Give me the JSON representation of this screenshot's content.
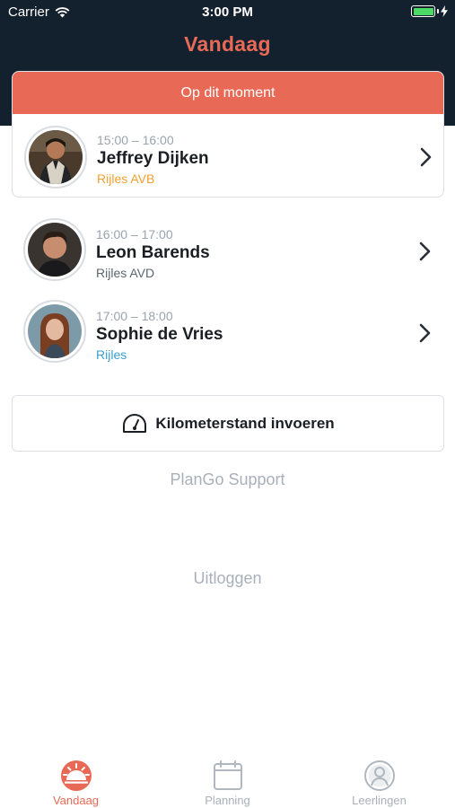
{
  "colors": {
    "header_bg": "#13202d",
    "accent": "#e86a56",
    "orange": "#f0a030",
    "teal_blue": "#3aa0d0",
    "muted": "#a9b0b9",
    "battery": "#4cd964"
  },
  "status_bar": {
    "carrier": "Carrier",
    "time": "3:00 PM",
    "battery_level": 1.0
  },
  "header": {
    "title": "Vandaag"
  },
  "current": {
    "heading": "Op dit moment",
    "appointment": {
      "time": "15:00 – 16:00",
      "name": "Jeffrey Dijken",
      "type": "Rijles AVB",
      "type_color": "#f0a030"
    }
  },
  "appointments": [
    {
      "time": "16:00 – 17:00",
      "name": "Leon Barends",
      "type": "Rijles AVD",
      "type_color": "#5a6670"
    },
    {
      "time": "17:00 – 18:00",
      "name": "Sophie de Vries",
      "type": "Rijles",
      "type_color": "#3aa0d0"
    }
  ],
  "actions": {
    "odometer": "Kilometerstand invoeren",
    "support": "PlanGo Support",
    "logout": "Uitloggen"
  },
  "tabs": [
    {
      "label": "Vandaag",
      "icon": "sunrise-icon",
      "active": true
    },
    {
      "label": "Planning",
      "icon": "calendar-icon",
      "active": false
    },
    {
      "label": "Leerlingen",
      "icon": "user-circle-icon",
      "active": false
    }
  ]
}
